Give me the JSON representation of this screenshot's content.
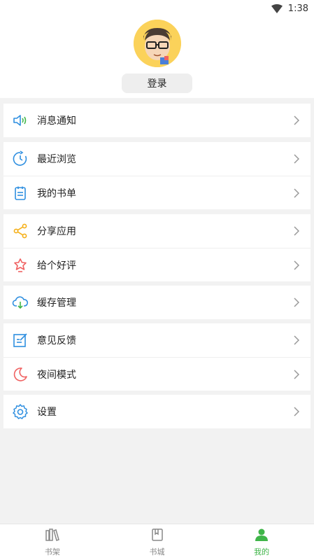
{
  "status_bar": {
    "time": "1:38",
    "wifi_icon": "wifi-icon"
  },
  "profile": {
    "avatar_icon": "avatar-cartoon-face",
    "login_label": "登录"
  },
  "menu_groups": [
    [
      {
        "label": "消息通知",
        "icon": "speaker-icon",
        "color": "#2f8fe0"
      }
    ],
    [
      {
        "label": "最近浏览",
        "icon": "clock-icon",
        "color": "#2f8fe0"
      },
      {
        "label": "我的书单",
        "icon": "list-icon",
        "color": "#2f8fe0"
      }
    ],
    [
      {
        "label": "分享应用",
        "icon": "share-icon",
        "color": "#f5b01a"
      },
      {
        "label": "给个好评",
        "icon": "thumbs-up-icon",
        "color": "#f06262"
      }
    ],
    [
      {
        "label": "缓存管理",
        "icon": "cloud-download-icon",
        "color": "#2f8fe0"
      }
    ],
    [
      {
        "label": "意见反馈",
        "icon": "feedback-icon",
        "color": "#2f8fe0"
      },
      {
        "label": "夜间模式",
        "icon": "moon-icon",
        "color": "#f06262"
      }
    ],
    [
      {
        "label": "设置",
        "icon": "gear-icon",
        "color": "#2f8fe0"
      }
    ]
  ],
  "bottom_nav": [
    {
      "label": "书架",
      "icon": "bookshelf-icon",
      "active": false
    },
    {
      "label": "书城",
      "icon": "bookstore-icon",
      "active": false
    },
    {
      "label": "我的",
      "icon": "person-icon",
      "active": true
    }
  ],
  "colors": {
    "accent_green": "#3fb549",
    "blue": "#2f8fe0",
    "red": "#f06262",
    "yellow": "#f5b01a"
  }
}
